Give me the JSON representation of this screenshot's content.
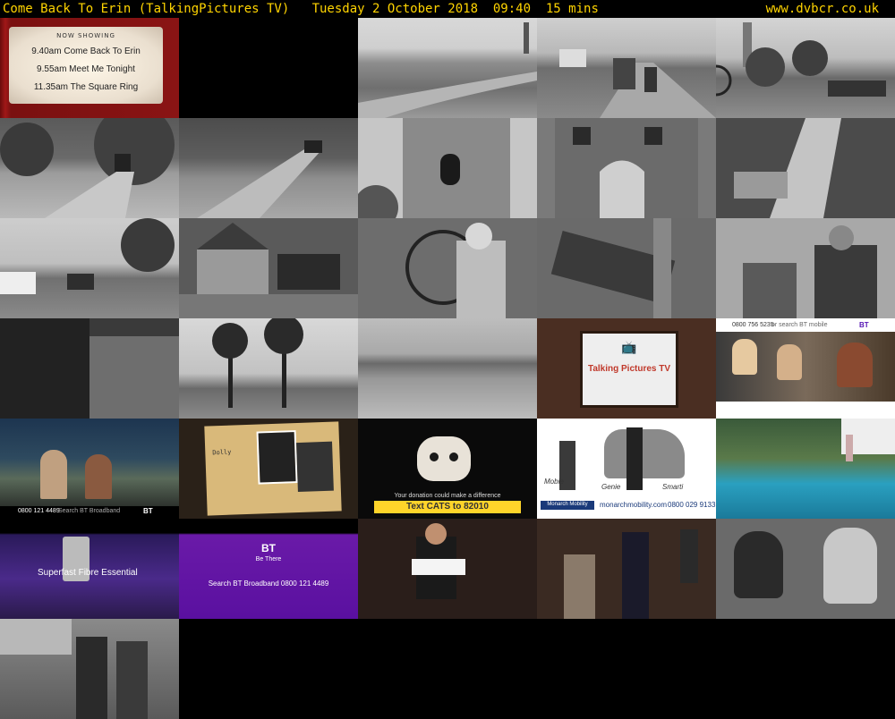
{
  "header": {
    "title": "Come Back To Erin (TalkingPictures TV)   Tuesday 2 October 2018  09:40  15 mins",
    "site": "www.dvbcr.co.uk"
  },
  "now_showing": {
    "heading": "NOW SHOWING",
    "items": [
      "9.40am Come Back To Erin",
      "9.55am Meet Me Tonight",
      "11.35am The Square Ring"
    ]
  },
  "ads": {
    "bt_mobile_phone": "0800 756 5235",
    "bt_mobile_search": "or search BT mobile",
    "bt_logo": "BT",
    "bt_broadband_phone": "0800 121 4489",
    "bt_broadband_search": "Search BT Broadband",
    "superfast": "Superfast Fibre Essential",
    "be_there": "Be There",
    "search_bt": "Search BT Broadband   0800 121 4489",
    "talking_pictures": "Talking Pictures TV",
    "cats_text": "Text CATS to 82010",
    "cats_label": "Your donation could make a difference",
    "folder_name": "Dolly",
    "mobility_site": "monarchmobility.com",
    "mobility_phone": "0800 029 9133",
    "mobility_brand": "Monarch Mobility",
    "mobility_models": [
      "Mobie",
      "Genie",
      "Smarti"
    ]
  }
}
